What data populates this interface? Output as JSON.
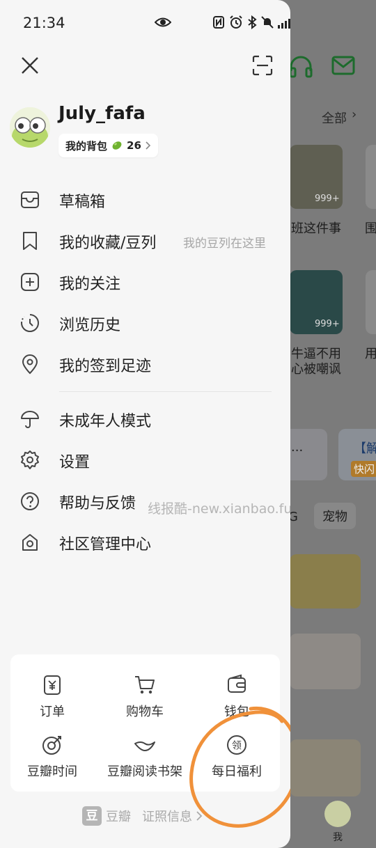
{
  "status_bar": {
    "time": "21:34",
    "battery": "46"
  },
  "profile": {
    "username": "July_fafa",
    "bag_label": "我的背包",
    "bag_count": "26"
  },
  "menu": [
    {
      "label": "草稿箱"
    },
    {
      "label": "我的收藏/豆列",
      "hint": "我的豆列在这里"
    },
    {
      "label": "我的关注"
    },
    {
      "label": "浏览历史"
    },
    {
      "label": "我的签到足迹"
    },
    {
      "label": "未成年人模式"
    },
    {
      "label": "设置"
    },
    {
      "label": "帮助与反馈"
    },
    {
      "label": "社区管理中心"
    }
  ],
  "grid": [
    {
      "label": "订单",
      "icon": "order-icon"
    },
    {
      "label": "购物车",
      "icon": "cart-icon"
    },
    {
      "label": "钱包",
      "icon": "wallet-icon"
    },
    {
      "label": "豆瓣时间",
      "icon": "douban-time-icon"
    },
    {
      "label": "豆瓣阅读书架",
      "icon": "reading-shelf-icon"
    },
    {
      "label": "每日福利",
      "icon": "daily-welfare-icon"
    }
  ],
  "daily_welfare_glyph": "领",
  "footer": {
    "logo_char": "豆",
    "brand": "豆瓣",
    "license": "证照信息"
  },
  "watermark": "线报酷-new.xianbao.fun",
  "background": {
    "all_label": "全部",
    "badge1": "999+",
    "badge2": "999+",
    "text1": "班这件事",
    "text2": "围",
    "text3": "牛逼不用",
    "text4": "心被嘲讽",
    "text5": "用",
    "promo_left": "...",
    "promo_right": "【解",
    "promo_tag": "快闪",
    "tag1": "G",
    "tag2": "宠物",
    "bottom_me": "我"
  },
  "colors": {
    "accent_green": "#2f9a3f",
    "annotation_orange": "#f0913a"
  }
}
